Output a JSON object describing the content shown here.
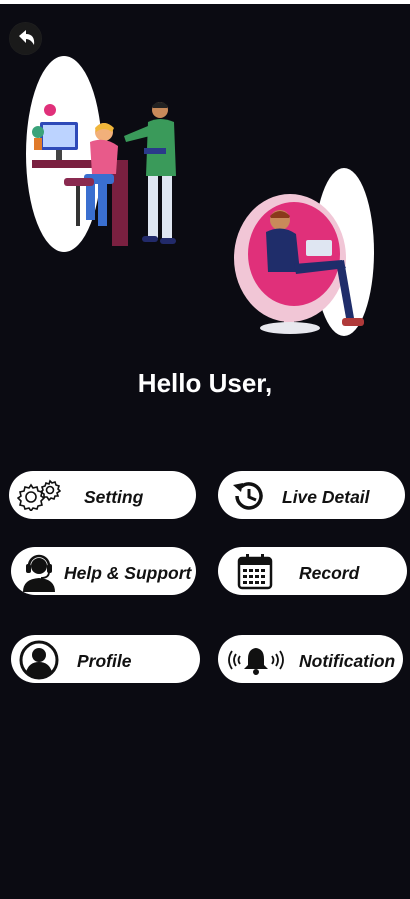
{
  "greeting": "Hello User,",
  "menu": {
    "setting": "Setting",
    "live_detail": "Live Detail",
    "help_support": "Help & Support",
    "record": "Record",
    "profile": "Profile",
    "notification": "Notification"
  },
  "icons": {
    "back": "back-arrow-icon",
    "setting": "gears-icon",
    "live_detail": "clock-history-icon",
    "help_support": "headset-support-icon",
    "record": "calendar-icon",
    "profile": "user-avatar-icon",
    "notification": "bell-ringing-icon"
  },
  "colors": {
    "background": "#0b0b12",
    "button": "#ffffff",
    "text_light": "#ffffff",
    "text_dark": "#111111",
    "accent_pink": "#e0307a"
  }
}
